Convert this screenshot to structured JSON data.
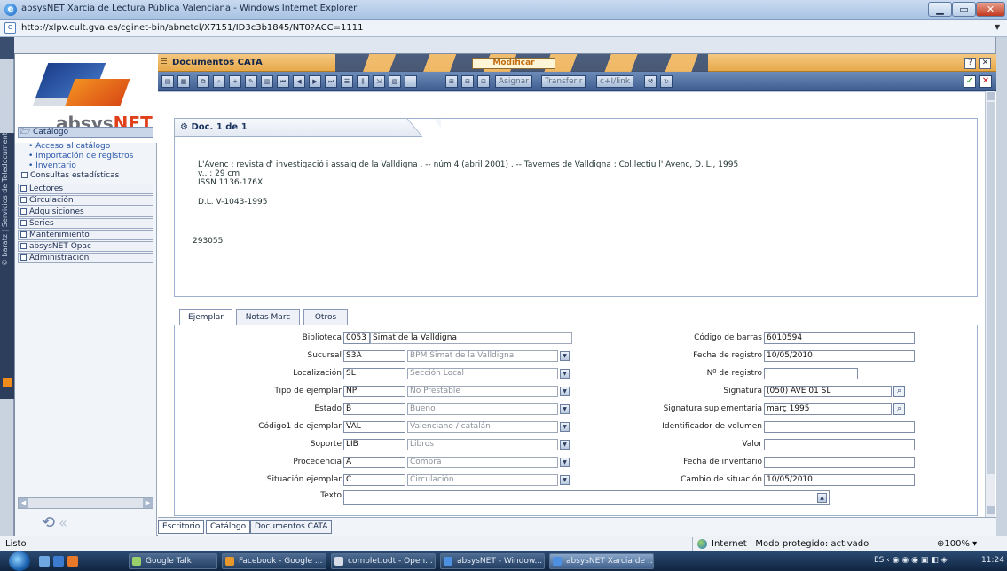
{
  "window": {
    "title": "absysNET Xarcia de Lectura Pública Valenciana - Windows Internet Explorer",
    "address": "http://xlpv.cult.gva.es/cginet-bin/abnetcl/X7151/ID3c3b1845/NT0?ACC=1111",
    "min_glyph": "▁",
    "max_glyph": "▭",
    "close_glyph": "✕"
  },
  "sidebar": {
    "logo": {
      "word_absys": "absys",
      "word_net": "NET"
    },
    "catalog_header": "Catálogo",
    "catalog_items": [
      {
        "label": "• Acceso al catálogo"
      },
      {
        "label": "• Importación de registros"
      },
      {
        "label": "• Inventario"
      }
    ],
    "catalog_stats": "Consultas estadísticas",
    "sections": [
      {
        "label": "Lectores"
      },
      {
        "label": "Circulación"
      },
      {
        "label": "Adquisiciones"
      },
      {
        "label": "Series"
      },
      {
        "label": "Mantenimiento"
      },
      {
        "label": "absysNET Opac"
      },
      {
        "label": "Administración"
      }
    ],
    "vertical_brand": "© baratz | Servicios de Teledocumentación, S.A."
  },
  "header": {
    "title": "Documentos CATA",
    "modify_button": "Modificar",
    "help_glyph": "?",
    "close_glyph": "✕"
  },
  "toolbar": {
    "assign_label": "Asignar",
    "transfer_label": "Transferir",
    "link_label": "c+I/link",
    "confirm_glyph": "✓",
    "cancel_glyph": "✕"
  },
  "record": {
    "header": "Doc. 1 de 1",
    "lines": [
      "L'Avenc : revista d' investigació i assaig de la Valldigna . -- núm 4 (abril 2001) . -- Tavernes de Valldigna : Col.lectiu l' Avenc, D. L., 1995",
      "v., ; 29 cm",
      "ISSN 1136-176X",
      "D.L. V-1043-1995",
      "293055"
    ]
  },
  "tabs": [
    {
      "label": "Ejemplar"
    },
    {
      "label": "Notas Marc"
    },
    {
      "label": "Otros"
    }
  ],
  "form": {
    "left": [
      {
        "label": "Biblioteca",
        "code": "0053",
        "desc": "Simat de la Valldigna"
      },
      {
        "label": "Sucursal",
        "code": "S3A",
        "desc": "BPM Simat de la Valldigna"
      },
      {
        "label": "Localización",
        "code": "SL",
        "desc": "Sección Local"
      },
      {
        "label": "Tipo de ejemplar",
        "code": "NP",
        "desc": "No Prestable"
      },
      {
        "label": "Estado",
        "code": "B",
        "desc": "Bueno"
      },
      {
        "label": "Código1 de ejemplar",
        "code": "VAL",
        "desc": "Valenciano / catalán"
      },
      {
        "label": "Soporte",
        "code": "LIB",
        "desc": "Libros"
      },
      {
        "label": "Procedencia",
        "code": "A",
        "desc": "Compra"
      },
      {
        "label": "Situación ejemplar",
        "code": "C",
        "desc": "Circulación"
      },
      {
        "label": "Texto",
        "code": "",
        "desc": ""
      }
    ],
    "right": [
      {
        "label": "Código de barras",
        "value": "6010594"
      },
      {
        "label": "Fecha de registro",
        "value": "10/05/2010"
      },
      {
        "label": "Nº de registro",
        "value": ""
      },
      {
        "label": "Signatura",
        "value": "(050) AVE 01 SL"
      },
      {
        "label": "Signatura suplementaria",
        "value": "març 1995"
      },
      {
        "label": "Identificador de volumen",
        "value": ""
      },
      {
        "label": "Valor",
        "value": ""
      },
      {
        "label": "Fecha de inventario",
        "value": ""
      },
      {
        "label": "Cambio de situación",
        "value": "10/05/2010"
      }
    ]
  },
  "bottom_tabs": [
    {
      "label": "Escritorio"
    },
    {
      "label": "Catálogo"
    },
    {
      "label": "Documentos CATA"
    }
  ],
  "statusbar": {
    "status": "Listo",
    "zone": "Internet | Modo protegido: activado",
    "zoom": "100%"
  },
  "taskbar": {
    "tasks": [
      {
        "label": "Google Talk"
      },
      {
        "label": "Facebook - Google ..."
      },
      {
        "label": "complet.odt - Open..."
      },
      {
        "label": "absysNET - Window..."
      },
      {
        "label": "absysNET Xarcia de ..."
      }
    ],
    "tray": "ES",
    "time": "11:24"
  }
}
